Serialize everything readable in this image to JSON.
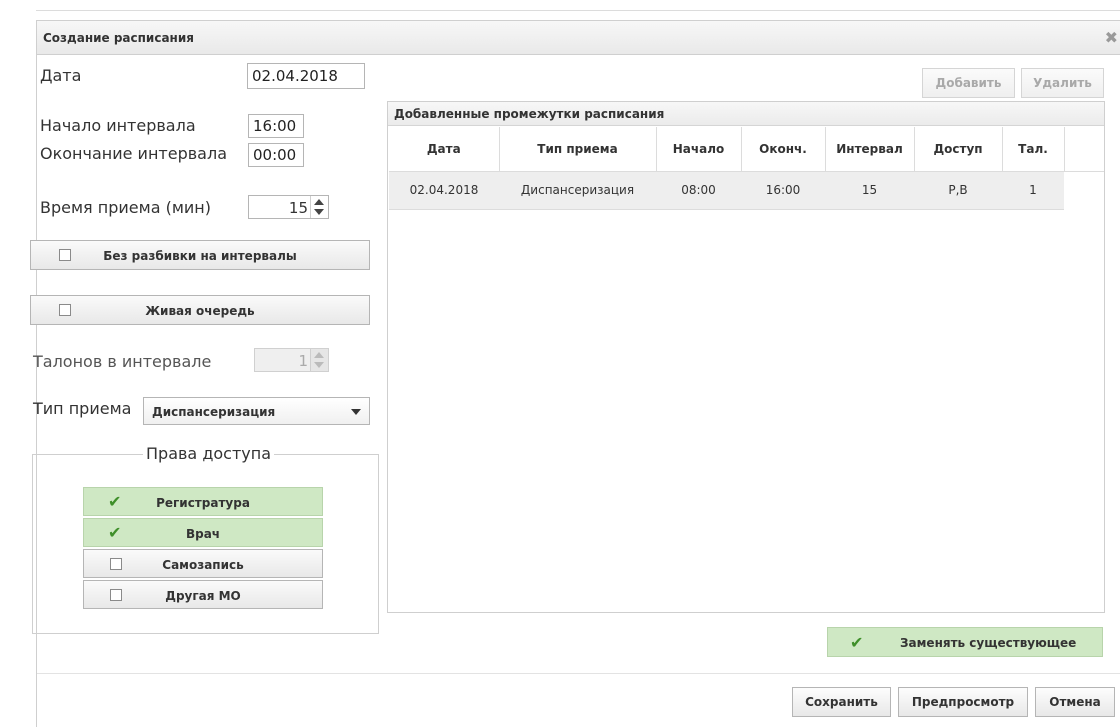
{
  "dialog": {
    "title": "Создание расписания"
  },
  "form": {
    "date_label": "Дата",
    "date_value": "02.04.2018",
    "start_label": "Начало интервала",
    "start_value": "16:00",
    "end_label": "Окончание интервала",
    "end_value": "00:00",
    "duration_label": "Время приема (мин)",
    "duration_value": "15",
    "no_split_label": "Без разбивки на интервалы",
    "live_queue_label": "Живая очередь",
    "tickets_label": "Талонов в интервале",
    "tickets_value": "1",
    "visit_type_label": "Тип приема",
    "visit_type_value": "Диспансеризация"
  },
  "access": {
    "legend": "Права доступа",
    "items": [
      {
        "label": "Регистратура",
        "checked": true
      },
      {
        "label": "Врач",
        "checked": true
      },
      {
        "label": "Самозапись",
        "checked": false
      },
      {
        "label": "Другая МО",
        "checked": false
      }
    ]
  },
  "toolbar": {
    "add_label": "Добавить",
    "delete_label": "Удалить"
  },
  "grid": {
    "title": "Добавленные промежутки расписания",
    "columns": [
      "Дата",
      "Тип приема",
      "Начало",
      "Оконч.",
      "Интервал",
      "Доступ",
      "Тал."
    ],
    "rows": [
      [
        "02.04.2018",
        "Диспансеризация",
        "08:00",
        "16:00",
        "15",
        "Р,В",
        "1"
      ]
    ]
  },
  "replace_existing_label": "Заменять существующее",
  "footer": {
    "save_label": "Сохранить",
    "preview_label": "Предпросмотр",
    "cancel_label": "Отмена"
  },
  "colors": {
    "checked_bg": "#cfe8c4",
    "check_mark": "#3f8f2a"
  }
}
